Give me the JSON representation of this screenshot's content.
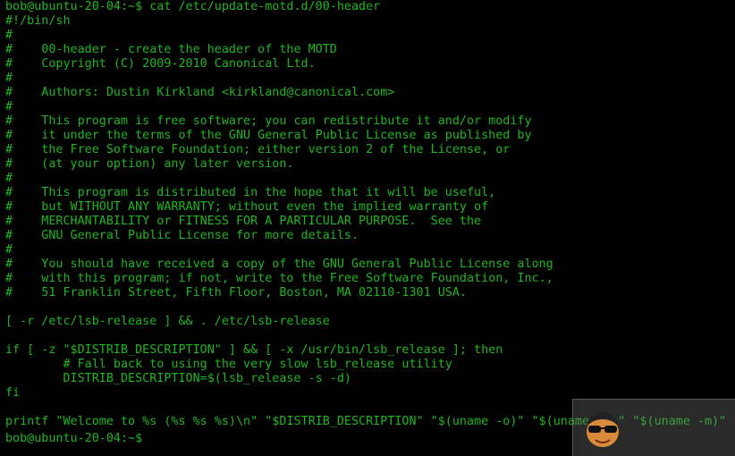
{
  "terminal": {
    "lines": [
      "bob@ubuntu-20-04:~$ cat /etc/update-motd.d/00-header",
      "#!/bin/sh",
      "#",
      "#    00-header - create the header of the MOTD",
      "#    Copyright (C) 2009-2010 Canonical Ltd.",
      "#",
      "#    Authors: Dustin Kirkland <kirkland@canonical.com>",
      "#",
      "#    This program is free software; you can redistribute it and/or modify",
      "#    it under the terms of the GNU General Public License as published by",
      "#    the Free Software Foundation; either version 2 of the License, or",
      "#    (at your option) any later version.",
      "#",
      "#    This program is distributed in the hope that it will be useful,",
      "#    but WITHOUT ANY WARRANTY; without even the implied warranty of",
      "#    MERCHANTABILITY or FITNESS FOR A PARTICULAR PURPOSE.  See the",
      "#    GNU General Public License for more details.",
      "#",
      "#    You should have received a copy of the GNU General Public License along",
      "#    with this program; if not, write to the Free Software Foundation, Inc.,",
      "#    51 Franklin Street, Fifth Floor, Boston, MA 02110-1301 USA.",
      "",
      "[ -r /etc/lsb-release ] && . /etc/lsb-release",
      "",
      "if [ -z \"$DISTRIB_DESCRIPTION\" ] && [ -x /usr/bin/lsb_release ]; then",
      "        # Fall back to using the very slow lsb_release utility",
      "        DISTRIB_DESCRIPTION=$(lsb_release -s -d)",
      "fi",
      "",
      "printf \"Welcome to %s (%s %s %s)\\n\" \"$DISTRIB_DESCRIPTION\" \"$(uname -o)\" \"$(uname -r)\" \"$(uname -m)\"",
      "bob@ubuntu-20-04:~$ "
    ],
    "text_color": "#1fb51f",
    "background_color": "#000000"
  },
  "watermark": {
    "icon": "hacker-face-icon"
  }
}
